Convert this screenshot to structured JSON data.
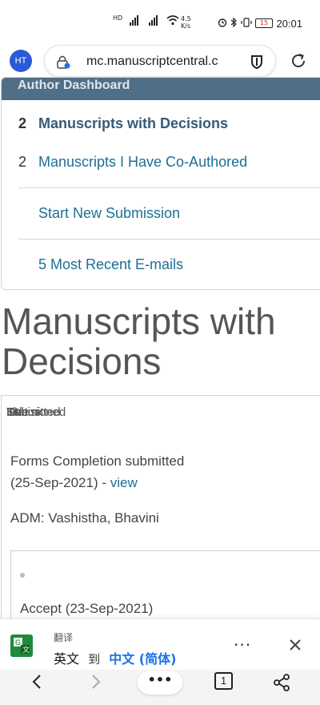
{
  "status_bar": {
    "hd_label": "HD",
    "sig1": "⁴⁶",
    "sig2": "⁴⁶",
    "speed": "4.5 K/s",
    "battery": "15",
    "time": "20:01"
  },
  "browser": {
    "avatar_initials": "HT",
    "url": "mc.manuscriptcentral.c"
  },
  "dashboard": {
    "header": "Author Dashboard",
    "items": [
      {
        "count": "2",
        "label": "Manuscripts with Decisions",
        "active": true
      },
      {
        "count": "2",
        "label": "Manuscripts I Have Co-Authored",
        "active": false
      },
      {
        "count": "",
        "label": "Start New Submission",
        "active": false
      },
      {
        "count": "",
        "label": "5 Most Recent E-mails",
        "active": false
      }
    ]
  },
  "page": {
    "title": "Manuscripts with Decisions"
  },
  "decision": {
    "overlap_labels": [
      "Status",
      "ID",
      "Title",
      "Submitted",
      "Decisioned"
    ],
    "forms_line1": "Forms Completion submitted",
    "forms_line2": "(25-Sep-2021) -",
    "view_link": "view",
    "adm": "ADM: Vashistha, Bhavini",
    "accept": "Accept (23-Sep-2021)"
  },
  "translate": {
    "title": "翻译",
    "source_lang": "英文",
    "to": "到",
    "target_lang": "中文 (简体)"
  },
  "nav": {
    "more": "•••",
    "tab_count": "1"
  },
  "colors": {
    "header_bg": "#4f6f88",
    "link": "#1d6f96",
    "avatar": "#2a5bd7",
    "translate_accent": "#1a73e8"
  }
}
